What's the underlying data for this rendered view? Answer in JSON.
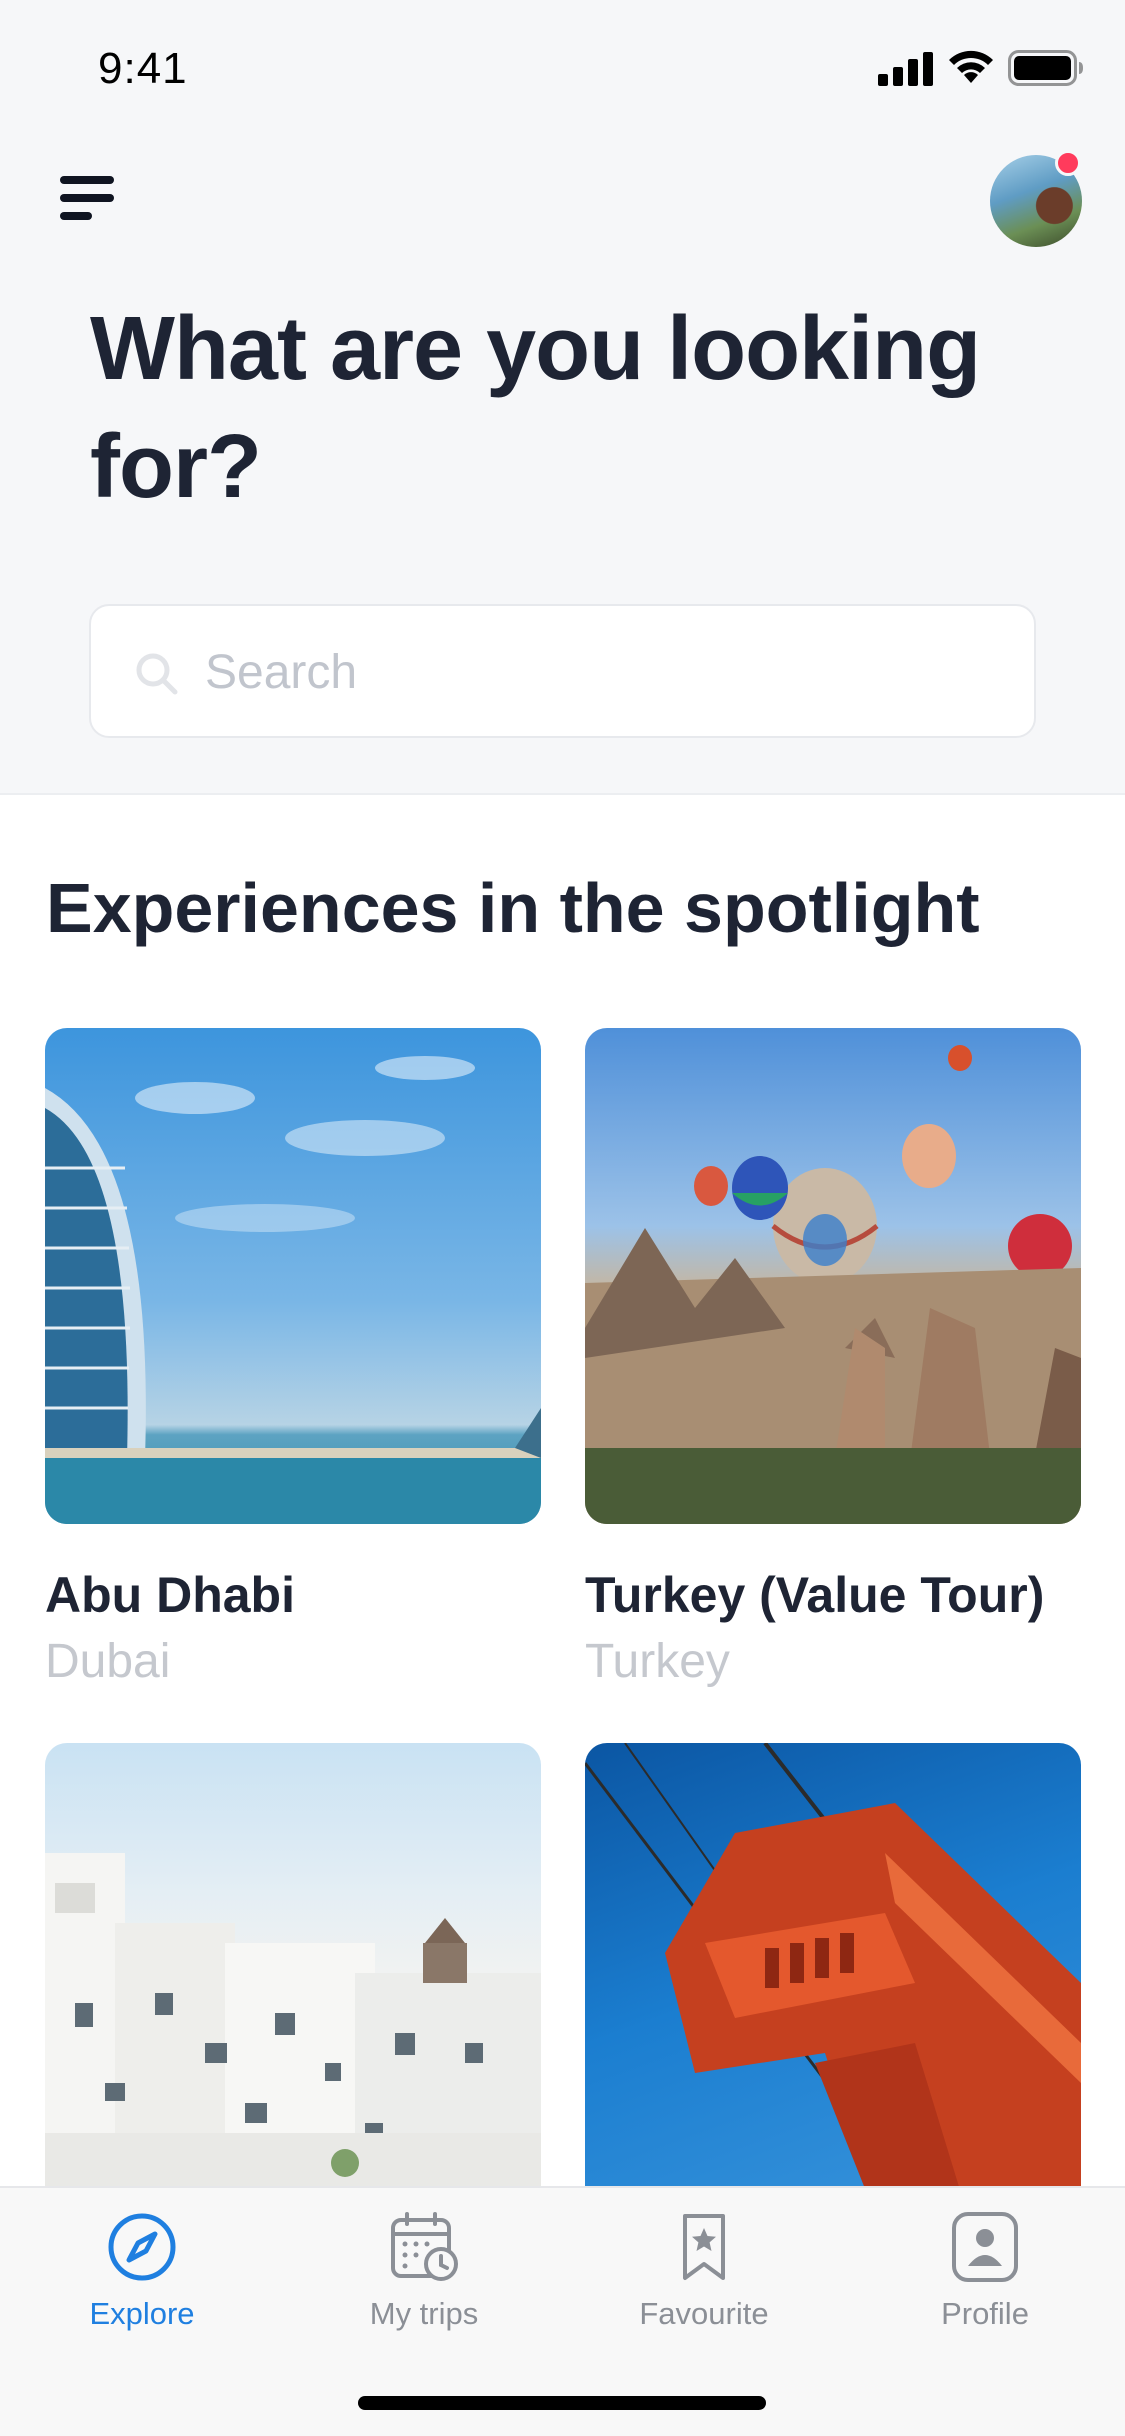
{
  "status_bar": {
    "time": "9:41"
  },
  "header": {
    "title": "What are you looking for?"
  },
  "search": {
    "placeholder": "Search",
    "value": ""
  },
  "section": {
    "title": "Experiences in the spotlight"
  },
  "cards": [
    {
      "title": "Abu Dhabi",
      "subtitle": "Dubai"
    },
    {
      "title": "Turkey (Value Tour)",
      "subtitle": "Turkey"
    },
    {
      "title": "",
      "subtitle": ""
    },
    {
      "title": "",
      "subtitle": ""
    }
  ],
  "tabs": [
    {
      "label": "Explore",
      "icon": "compass-icon",
      "active": true
    },
    {
      "label": "My trips",
      "icon": "calendar-clock-icon",
      "active": false
    },
    {
      "label": "Favourite",
      "icon": "bookmark-star-icon",
      "active": false
    },
    {
      "label": "Profile",
      "icon": "profile-icon",
      "active": false
    }
  ],
  "colors": {
    "accent": "#1f7fe0",
    "notification": "#ff3b5c",
    "text": "#1e2434",
    "muted": "#c5c8ce"
  }
}
